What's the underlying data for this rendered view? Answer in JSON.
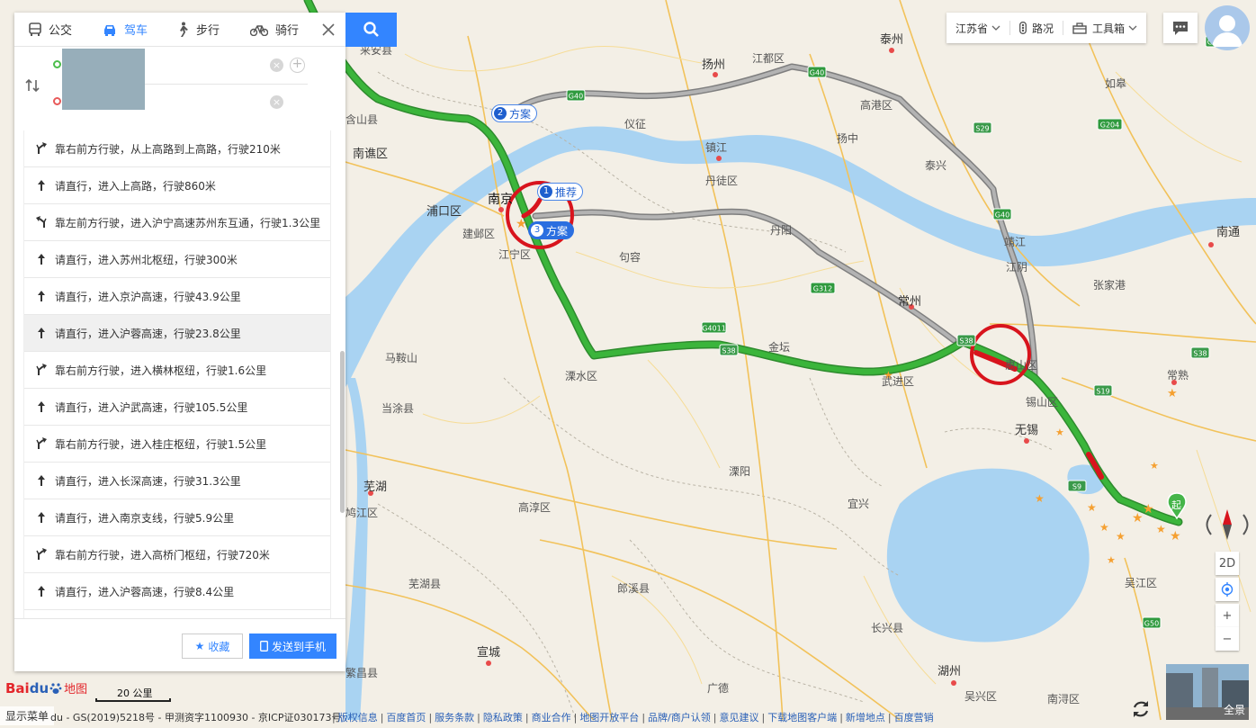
{
  "modes": [
    {
      "label": "公交",
      "icon": "bus-icon"
    },
    {
      "label": "驾车",
      "icon": "car-icon"
    },
    {
      "label": "步行",
      "icon": "walk-icon"
    },
    {
      "label": "骑行",
      "icon": "bike-icon"
    }
  ],
  "active_mode": "驾车",
  "steps": [
    {
      "text": "靠右前方行驶，从上高路到上高路，行驶210米",
      "icon": "bear-right-icon"
    },
    {
      "text": "请直行，进入上高路，行驶860米",
      "icon": "straight-arrow-icon"
    },
    {
      "text": "靠左前方行驶，进入沪宁高速苏州东互通，行驶1.3公里",
      "icon": "bear-left-icon"
    },
    {
      "text": "请直行，进入苏州北枢纽，行驶300米",
      "icon": "straight-arrow-icon"
    },
    {
      "text": "请直行，进入京沪高速，行驶43.9公里",
      "icon": "straight-arrow-icon"
    },
    {
      "text": "请直行，进入沪蓉高速，行驶23.8公里",
      "icon": "straight-arrow-icon"
    },
    {
      "text": "靠右前方行驶，进入横林枢纽，行驶1.6公里",
      "icon": "bear-right-icon"
    },
    {
      "text": "请直行，进入沪武高速，行驶105.5公里",
      "icon": "straight-arrow-icon"
    },
    {
      "text": "靠右前方行驶，进入桂庄枢纽，行驶1.5公里",
      "icon": "bear-right-icon"
    },
    {
      "text": "请直行，进入长深高速，行驶31.3公里",
      "icon": "straight-arrow-icon"
    },
    {
      "text": "请直行，进入南京支线，行驶5.9公里",
      "icon": "straight-arrow-icon"
    },
    {
      "text": "靠右前方行驶，进入高桥门枢纽，行驶720米",
      "icon": "bear-right-icon"
    },
    {
      "text": "请直行，进入沪蓉高速，行驶8.4公里",
      "icon": "straight-arrow-icon"
    }
  ],
  "footer_buttons": {
    "favorite": "收藏",
    "send_to_phone": "发送到手机"
  },
  "toolbar": {
    "province": "江苏省",
    "traffic": "路况",
    "toolbox": "工具箱"
  },
  "map_controls": {
    "view_mode": "2D",
    "zoom_in": "+",
    "zoom_out": "−",
    "streetview": "全景"
  },
  "route_tags": [
    {
      "num": "1",
      "label": "推荐"
    },
    {
      "num": "2",
      "label": "方案"
    },
    {
      "num": "3",
      "label": "方案"
    }
  ],
  "start_marker": "起",
  "scale": "20 公里",
  "logo": {
    "en_a": "Bai",
    "en_b": "du",
    "cn": "地图"
  },
  "menu_toggle": "显示菜单",
  "copyright": "du - GS(2019)5218号 - 甲测资字1100930 - 京ICP证030173号",
  "footer_links": [
    "版权信息",
    "百度首页",
    "服务条款",
    "隐私政策",
    "商业合作",
    "地图开放平台",
    "品牌/商户认领",
    "意见建议",
    "下载地图客户端",
    "新增地点",
    "百度营销"
  ],
  "road_shields": [
    "G40",
    "G40",
    "G40",
    "G40",
    "S29",
    "G204",
    "G312",
    "G4011",
    "S38",
    "S38",
    "S38",
    "S19",
    "S9",
    "G50"
  ],
  "map_labels": [
    "来安县",
    "扬州",
    "江都区",
    "泰州",
    "如皋",
    "仪征",
    "高港区",
    "扬中",
    "镇江",
    "南谯区",
    "泰兴",
    "丹徒区",
    "浦口区",
    "南京",
    "建邺区",
    "江宁区",
    "句容",
    "丹阳",
    "靖江",
    "江阴",
    "南通",
    "张家港",
    "常州",
    "常熟",
    "马鞍山",
    "溧水区",
    "金坛",
    "武进区",
    "惠山区",
    "锡山区",
    "无锡",
    "当涂县",
    "芜湖",
    "溧阳",
    "宜兴",
    "高淳区",
    "鸠江区",
    "芜湖县",
    "郎溪县",
    "宣城",
    "长兴县",
    "湖州",
    "吴江区",
    "繁昌县",
    "广德",
    "吴兴区",
    "南浔区",
    "含山县"
  ],
  "colors": {
    "accent": "#3385ff",
    "route_green": "#3bb53b",
    "route_gray": "#9a9a9a",
    "traffic_red": "#d8141d",
    "water": "#a9d3f2",
    "land": "#f3efe6"
  }
}
